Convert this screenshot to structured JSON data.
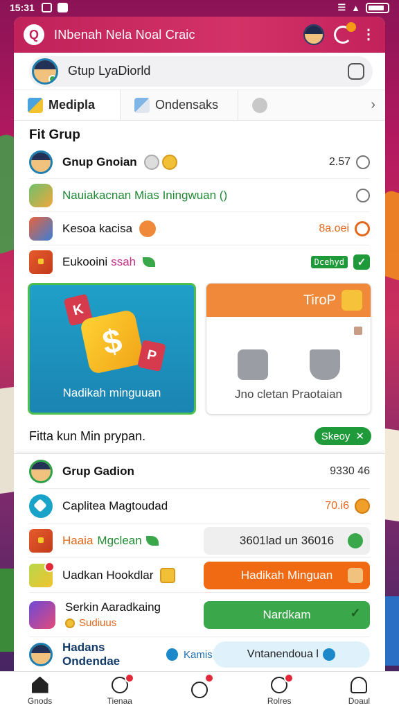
{
  "status_bar": {
    "time": "15:31"
  },
  "app_bar": {
    "title": "INbenah Nela Noal Craic"
  },
  "profile": {
    "name": "Gtup LyaDiorld"
  },
  "tabs": [
    {
      "label": "Medipla"
    },
    {
      "label": "Ondensaks"
    }
  ],
  "section": {
    "title": "Fit Grup",
    "rows": [
      {
        "label": "Gnup Gnoian",
        "value": "2.57"
      },
      {
        "label": "Nauiakacnan Mias Iningwuan ()"
      },
      {
        "label": "Kesoa kacisa",
        "value": "8a.oei"
      },
      {
        "label": "Eukooini",
        "label_accent": "ssah",
        "tag": "Dcehyd"
      }
    ]
  },
  "cards": [
    {
      "caption": "Nadikah minguuan",
      "tile_a": "K",
      "tile_b": "P",
      "bag_symbol": "$"
    },
    {
      "header": "TiroP",
      "caption": "Jno cletan Praotaian"
    }
  ],
  "promo": {
    "text": "Fitta kun Min prypan.",
    "button": "Skeoy"
  },
  "sheet": {
    "rows": [
      {
        "label": "Grup Gadion",
        "value": "9330 46"
      },
      {
        "label": "Caplitea Magtoudad",
        "value": "70.i6"
      },
      {
        "label": "Haaia",
        "label_accent": "Mgclean",
        "button": "3601lad un 36016"
      },
      {
        "label": "Uadkan Hookdlar",
        "button": "Hadikah Minguan"
      },
      {
        "label": "Serkin Aaradkaing",
        "sub": "Sudiuus",
        "button": "Nardkam"
      }
    ],
    "last_row": {
      "label": "Hadans Ondendae",
      "sub": "Kamis",
      "pill": "Vntanendoua l"
    }
  },
  "bottom_nav": [
    {
      "label": "Gnods"
    },
    {
      "label": "Tienaa"
    },
    {
      "label": ""
    },
    {
      "label": "Rolres"
    },
    {
      "label": "Doaul"
    }
  ]
}
